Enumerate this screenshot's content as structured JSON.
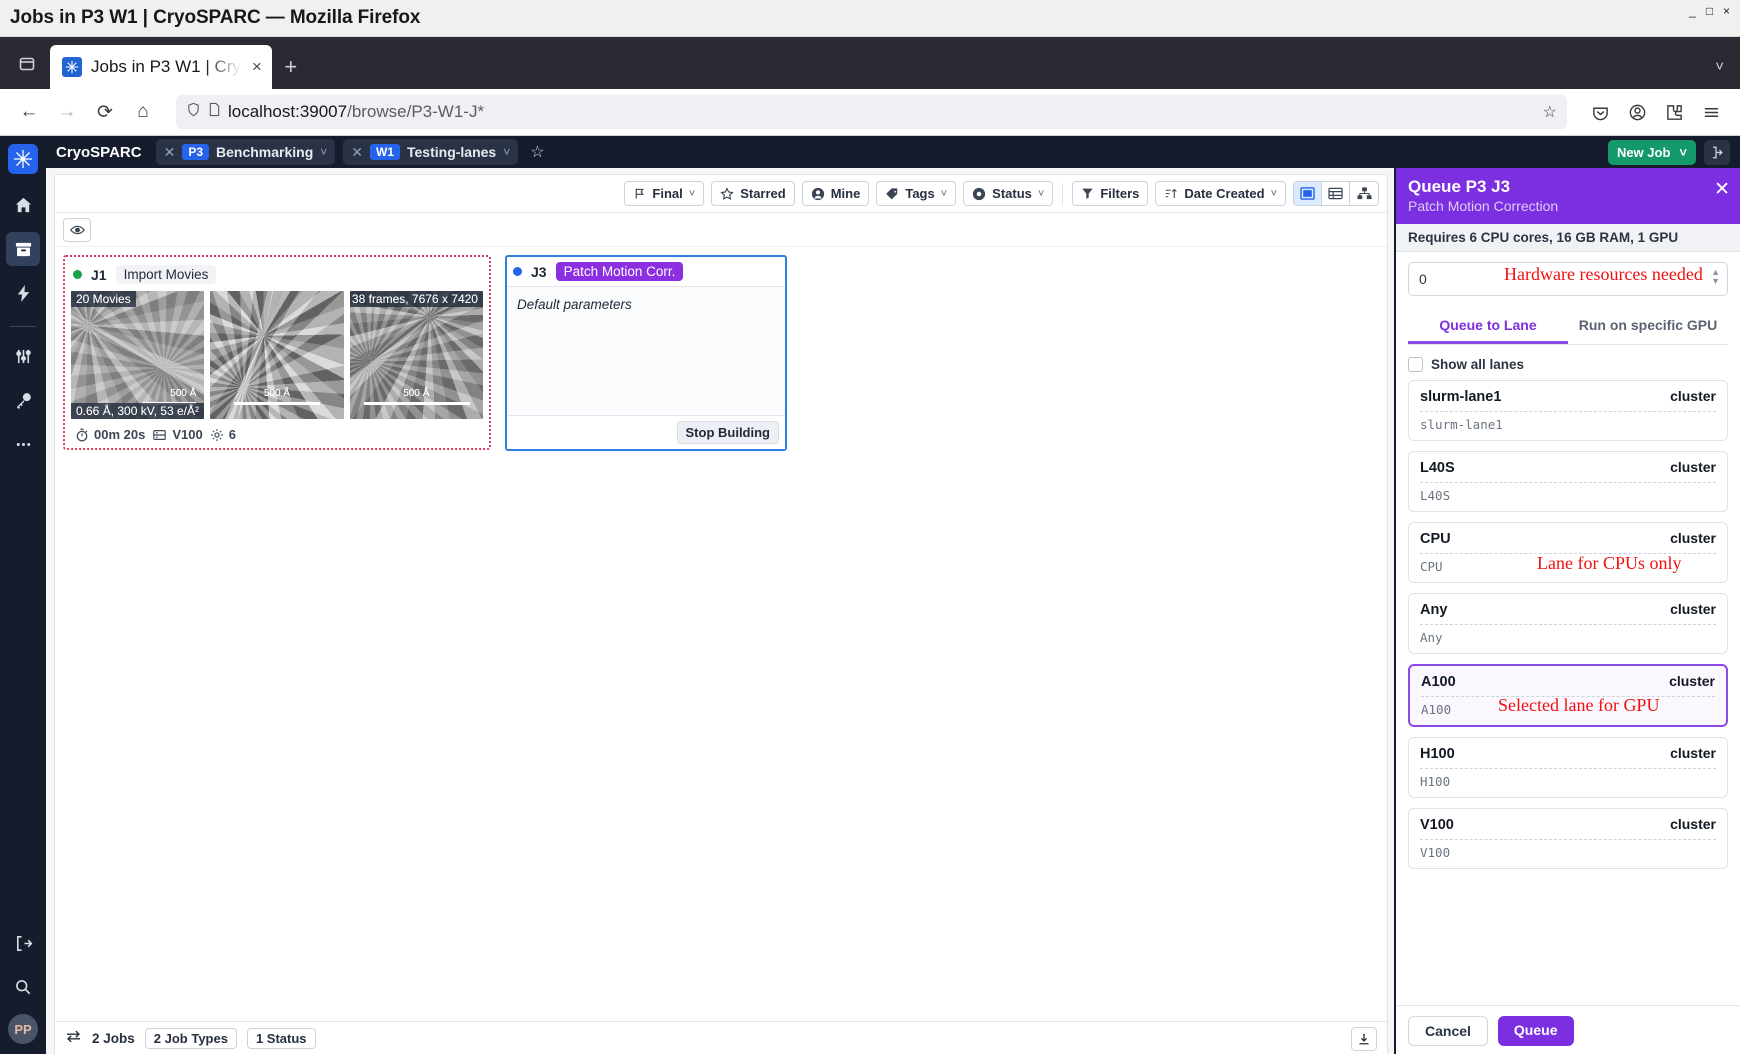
{
  "browser": {
    "window_title": "Jobs in P3 W1 | CryoSPARC — Mozilla Firefox",
    "tab_title": "Jobs in P3 W1 | Cry",
    "url_host": "localhost:39007",
    "url_path": "/browse/P3-W1-J*",
    "new_tab_label": "+",
    "close_label": "×",
    "win_min": "_",
    "win_max": "□",
    "win_close": "×"
  },
  "sidebar": {
    "logo": "cryosparc-logo-icon",
    "items": [
      {
        "name": "home-icon",
        "active": false
      },
      {
        "name": "projects-archive-icon",
        "active": true
      },
      {
        "name": "lightning-icon",
        "active": false
      },
      {
        "name": "sliders-icon",
        "active": false
      },
      {
        "name": "key-icon",
        "active": false
      },
      {
        "name": "more-ellipsis-icon",
        "active": false
      }
    ],
    "bottom": [
      {
        "name": "logout-icon"
      },
      {
        "name": "search-icon"
      }
    ],
    "avatar_initials": "PP"
  },
  "topbar": {
    "brand": "CryoSPARC",
    "project": {
      "tag": "P3",
      "name": "Benchmarking"
    },
    "workspace": {
      "tag": "W1",
      "name": "Testing-lanes"
    },
    "new_job_label": "New Job",
    "star_icon": "star-outline-icon",
    "collapse_icon": "panel-collapse-icon"
  },
  "filterbar": {
    "buttons": [
      {
        "label": "Final",
        "icon": "flag-icon",
        "caret": true
      },
      {
        "label": "Starred",
        "icon": "star-icon",
        "caret": false
      },
      {
        "label": "Mine",
        "icon": "user-icon",
        "caret": false
      },
      {
        "label": "Tags",
        "icon": "tag-icon",
        "caret": true
      },
      {
        "label": "Status",
        "icon": "status-circle-icon",
        "caret": true
      }
    ],
    "filters_label": "Filters",
    "sort_label": "Date Created",
    "views": [
      {
        "name": "card-view",
        "active": true
      },
      {
        "name": "table-view",
        "active": false
      },
      {
        "name": "tree-view",
        "active": false
      }
    ],
    "eye_icon": "eye-icon"
  },
  "jobs": [
    {
      "id": "J1",
      "type": "Import Movies",
      "status_color": "#16a34a",
      "selected": true,
      "thumbs": [
        {
          "top_left": "20 Movies",
          "bottom_left": "0.66 Å, 300 kV, 53 e/Å²",
          "scale": "500 Å"
        },
        {
          "top_left": "",
          "bottom_left": "",
          "scale": "500 Å"
        },
        {
          "top_right": "38 frames, 7676 x 7420",
          "bottom_left": "",
          "scale": "500 Å"
        }
      ],
      "footer": {
        "duration": "00m 20s",
        "lane": "V100",
        "cpus": "6",
        "timer_icon": "stopwatch-icon",
        "lane_icon": "server-icon",
        "gear_icon": "gear-icon"
      }
    },
    {
      "id": "J3",
      "type": "Patch Motion Corr.",
      "status_color": "#2563eb",
      "building": true,
      "body_text": "Default parameters",
      "stop_label": "Stop Building"
    }
  ],
  "statusbar": {
    "toggle_icon": "swap-arrows-icon",
    "jobs_count": "2 Jobs",
    "job_types": "2 Job Types",
    "statuses": "1 Status",
    "download_icon": "download-icon"
  },
  "queue_panel": {
    "title": "Queue P3 J3",
    "subtitle": "Patch Motion Correction",
    "close_icon": "close-icon",
    "requires": "Requires 6 CPU cores, 16 GB RAM, 1 GPU",
    "number_value": "0",
    "tabs": [
      {
        "label": "Queue to Lane",
        "active": true
      },
      {
        "label": "Run on specific GPU",
        "active": false
      }
    ],
    "show_all_lanes_label": "Show all lanes",
    "show_all_lanes_checked": false,
    "lanes": [
      {
        "name": "slurm-lane1",
        "type": "cluster",
        "sub": "slurm-lane1",
        "selected": false
      },
      {
        "name": "L40S",
        "type": "cluster",
        "sub": "L40S",
        "selected": false
      },
      {
        "name": "CPU",
        "type": "cluster",
        "sub": "CPU",
        "selected": false
      },
      {
        "name": "Any",
        "type": "cluster",
        "sub": "Any",
        "selected": false
      },
      {
        "name": "A100",
        "type": "cluster",
        "sub": "A100",
        "selected": true
      },
      {
        "name": "H100",
        "type": "cluster",
        "sub": "H100",
        "selected": false
      },
      {
        "name": "V100",
        "type": "cluster",
        "sub": "V100",
        "selected": false
      }
    ],
    "cancel_label": "Cancel",
    "queue_label": "Queue"
  },
  "annotations": [
    {
      "id": "anno-hardware",
      "text": "Hardware resources needed"
    },
    {
      "id": "anno-cpu-lane",
      "text": "Lane for CPUs only"
    },
    {
      "id": "anno-selected-lane",
      "text": "Selected lane for GPU"
    }
  ],
  "colors": {
    "accent_purple": "#7c2fe0",
    "green": "#14996b",
    "blue": "#2563eb",
    "annotation_red": "#f01010"
  }
}
